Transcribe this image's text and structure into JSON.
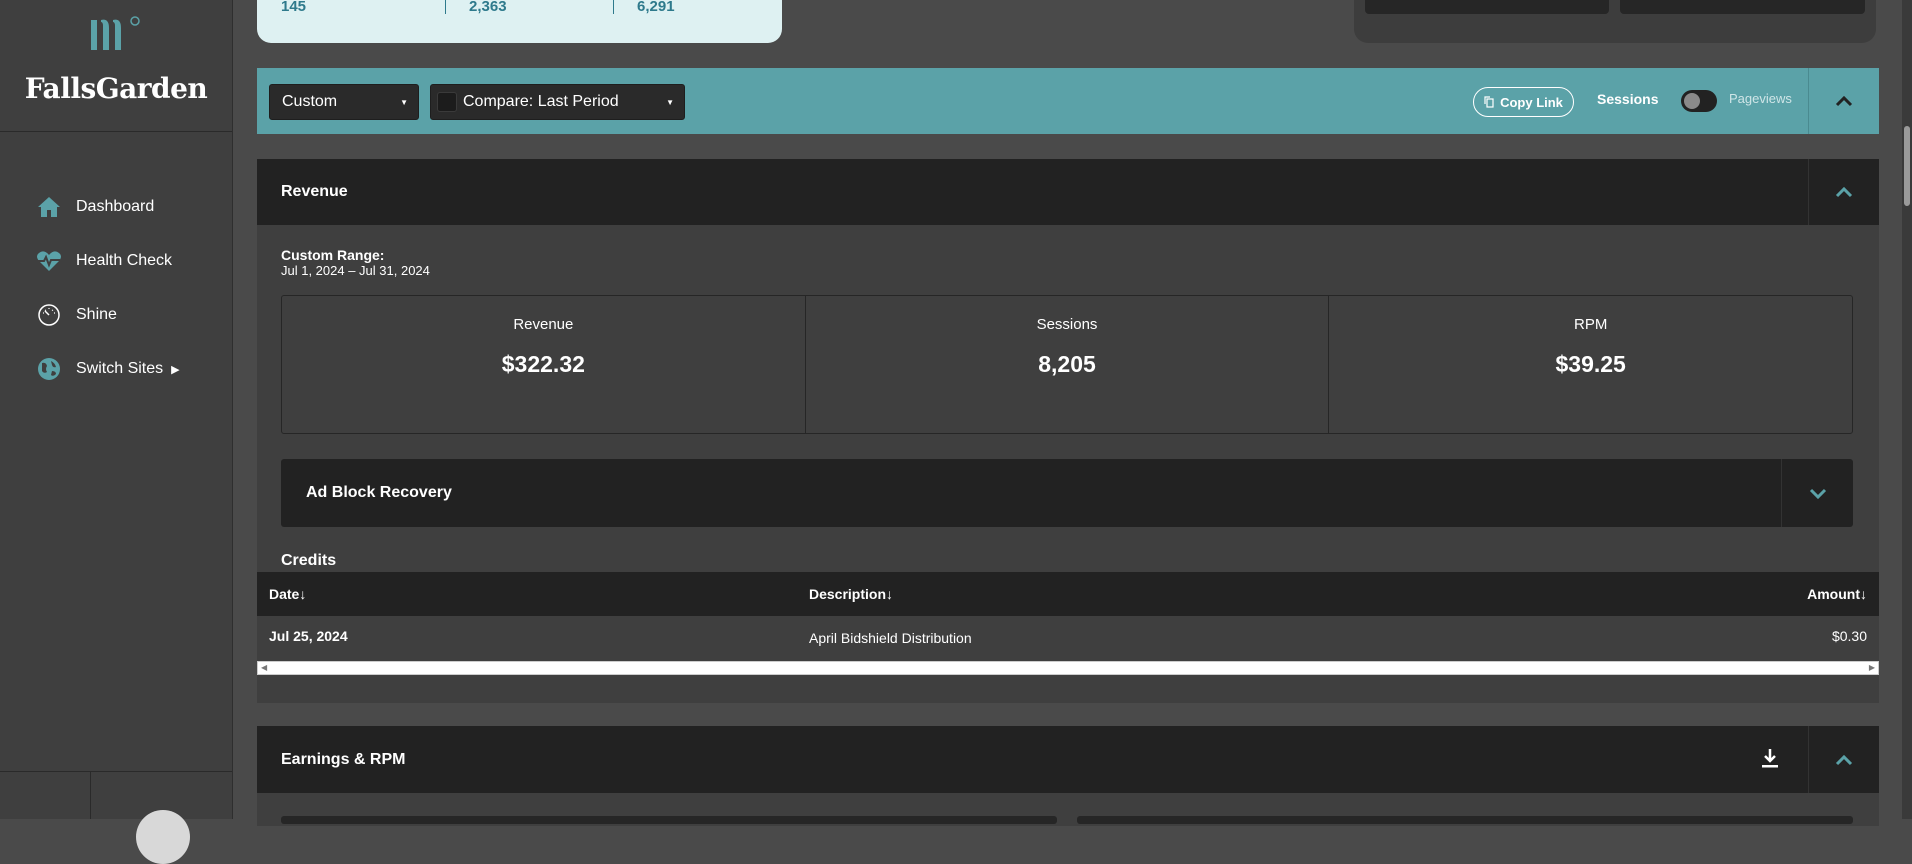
{
  "app": {
    "name": "FallsGarden"
  },
  "sidebar": {
    "items": [
      {
        "label": "Dashboard",
        "icon": "home-icon"
      },
      {
        "label": "Health Check",
        "icon": "heart-pulse-icon"
      },
      {
        "label": "Shine",
        "icon": "gauge-icon"
      },
      {
        "label": "Switch Sites",
        "icon": "globe-icon"
      }
    ]
  },
  "top_card": {
    "values": [
      "145",
      "2,363",
      "6,291"
    ]
  },
  "filters": {
    "range_select": "Custom",
    "compare_select": "Compare: Last Period",
    "copy_link": "Copy Link",
    "toggle_left": "Sessions",
    "toggle_right": "Pageviews"
  },
  "revenue": {
    "title": "Revenue",
    "range_title": "Custom Range:",
    "range_dates": "Jul 1, 2024 – Jul 31, 2024",
    "stats": [
      {
        "label": "Revenue",
        "value": "$322.32"
      },
      {
        "label": "Sessions",
        "value": "8,205"
      },
      {
        "label": "RPM",
        "value": "$39.25"
      }
    ],
    "ad_block": "Ad Block Recovery",
    "credits": {
      "title": "Credits",
      "columns": [
        "Date",
        "Description",
        "Amount"
      ],
      "rows": [
        {
          "date": "Jul 25, 2024",
          "description": "April Bidshield Distribution",
          "amount": "$0.30"
        }
      ]
    }
  },
  "earnings": {
    "title": "Earnings & RPM"
  },
  "colors": {
    "accent": "#5ba2a8",
    "dark": "#222222",
    "bg": "#4a4a4a"
  }
}
